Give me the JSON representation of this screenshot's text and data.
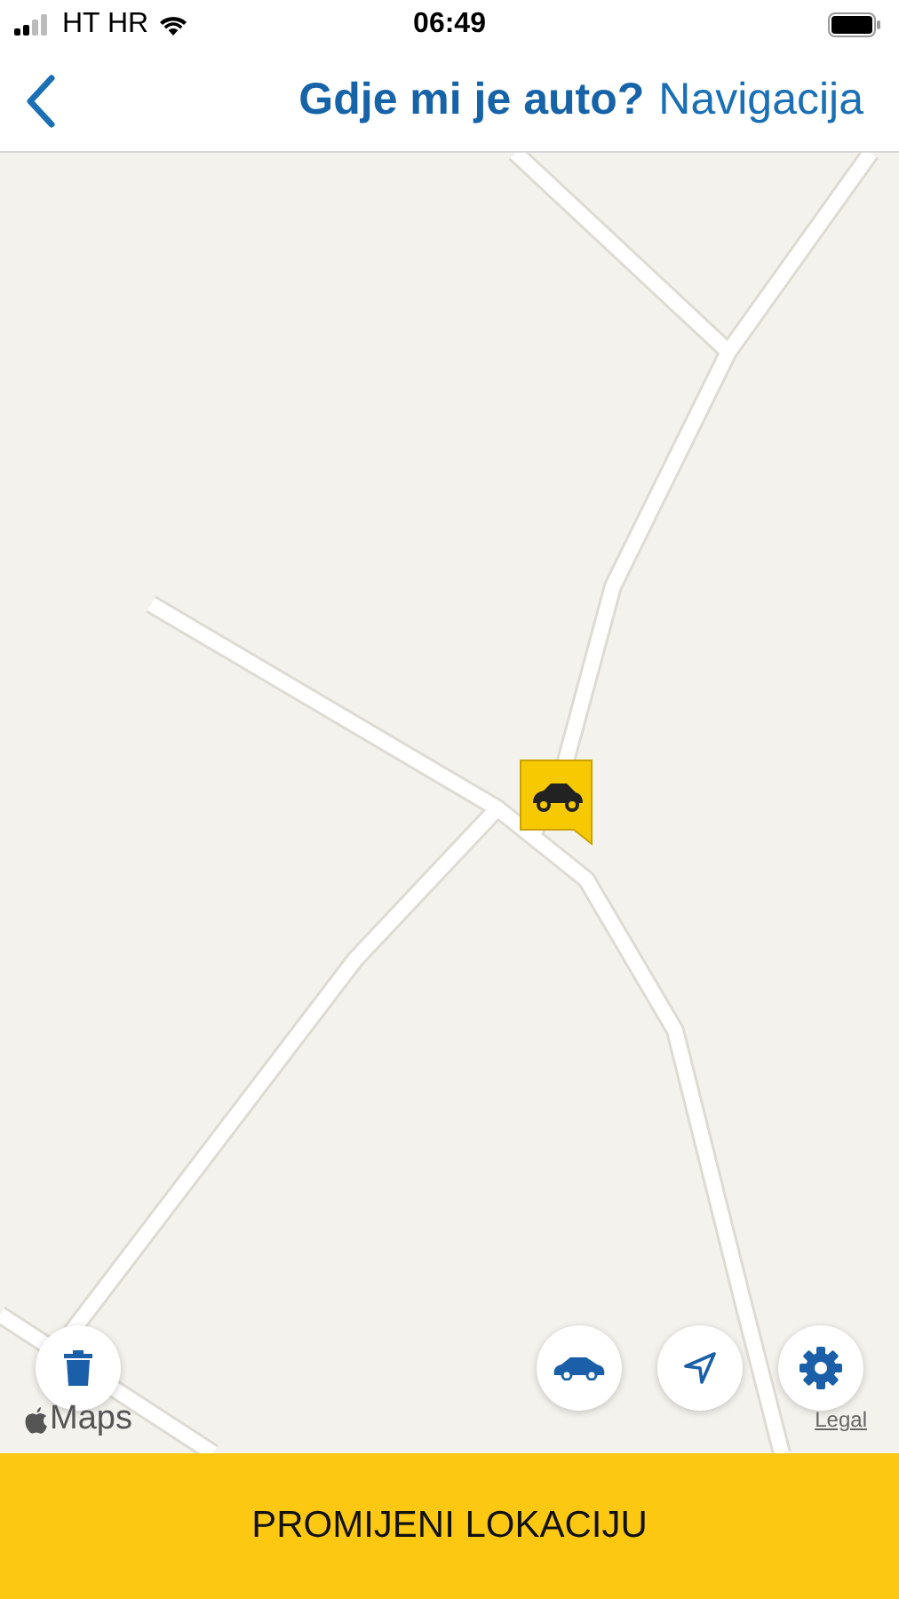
{
  "status_bar": {
    "carrier": "HT HR",
    "time": "06:49"
  },
  "nav": {
    "title": "Gdje mi je auto?",
    "subtitle": "Navigacija"
  },
  "map": {
    "kind": "picture",
    "attribution": "Maps",
    "legal": "Legal"
  },
  "map_buttons": [
    {
      "kind": "delete"
    },
    {
      "kind": "car"
    },
    {
      "kind": "locate"
    },
    {
      "kind": "settings"
    }
  ],
  "action_button": "PROMIJENI LOKACIJU"
}
